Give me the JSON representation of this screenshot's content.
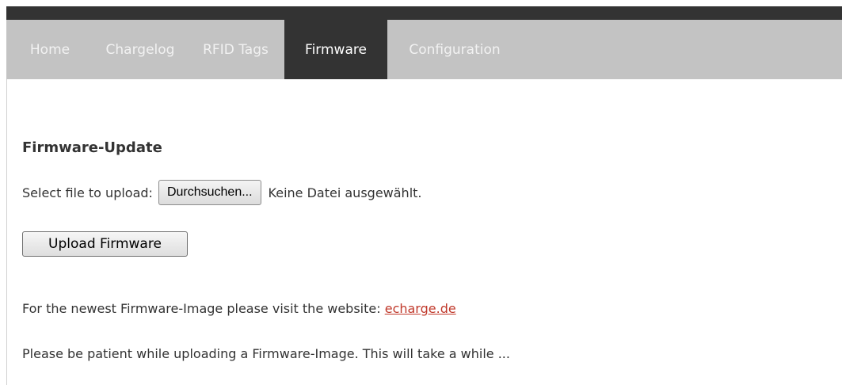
{
  "nav": {
    "items": [
      {
        "label": "Home",
        "active": false
      },
      {
        "label": "Chargelog",
        "active": false
      },
      {
        "label": "RFID Tags",
        "active": false
      },
      {
        "label": "Firmware",
        "active": true
      },
      {
        "label": "Configuration",
        "active": false
      }
    ]
  },
  "firmware": {
    "title": "Firmware-Update",
    "select_label": "Select file to upload:",
    "browse_button": "Durchsuchen...",
    "no_file_text": "Keine Datei ausgewählt.",
    "upload_button": "Upload Firmware",
    "info_text": "For the newest Firmware-Image please visit the website: ",
    "link_text": "echarge.de",
    "patience_text": "Please be patient while uploading a Firmware-Image. This will take a while ..."
  },
  "colors": {
    "topbar": "#333333",
    "navbar": "#c3c3c3",
    "active_tab": "#333333",
    "link": "#c0392b"
  }
}
